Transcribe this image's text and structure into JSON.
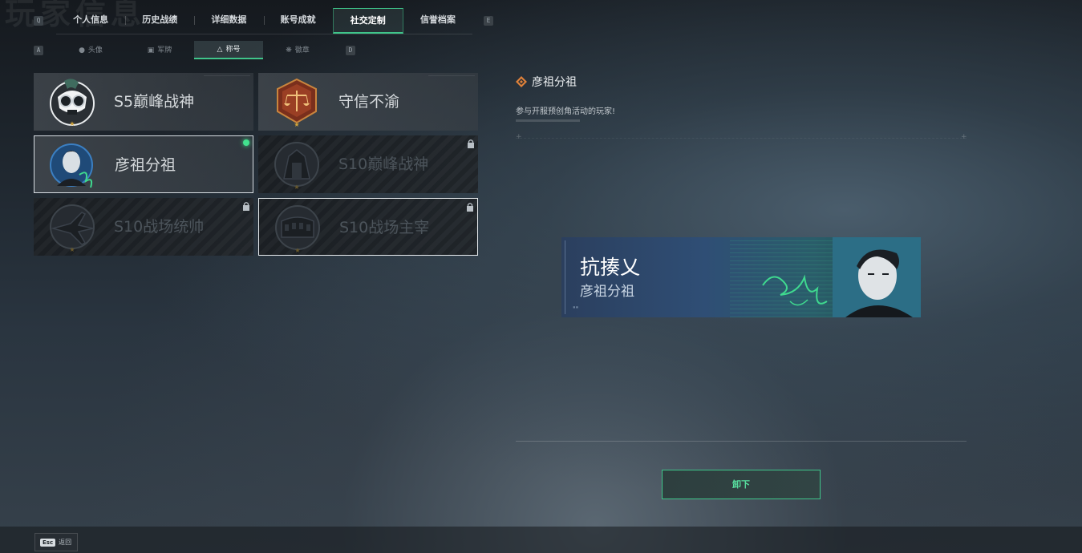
{
  "header": {
    "bg_title": "玩家信息",
    "left_key": "Q",
    "right_key": "E",
    "tabs": [
      "个人信息",
      "历史战绩",
      "详细数据",
      "账号成就",
      "社交定制",
      "信誉档案"
    ],
    "active_tab": "社交定制"
  },
  "subnav": {
    "left_key": "A",
    "right_key": "D",
    "tabs": [
      {
        "icon": "person-icon",
        "label": "头像"
      },
      {
        "icon": "card-icon",
        "label": "军牌"
      },
      {
        "icon": "triangle-icon",
        "label": "称号"
      },
      {
        "icon": "emblem-icon",
        "label": "徽章"
      }
    ],
    "active_tab": "称号"
  },
  "titles": [
    {
      "name": "S5巅峰战神",
      "locked": false,
      "emblem": "skull-goggles-emblem"
    },
    {
      "name": "守信不渝",
      "locked": false,
      "emblem": "scales-emblem"
    },
    {
      "name": "彦祖分祖",
      "locked": false,
      "equipped": true,
      "emblem": "portrait-emblem"
    },
    {
      "name": "S10巅峰战神",
      "locked": true,
      "emblem": "monument-emblem"
    },
    {
      "name": "S10战场统帅",
      "locked": true,
      "emblem": "aircraft-emblem"
    },
    {
      "name": "S10战场主宰",
      "locked": true,
      "emblem": "colosseum-emblem"
    }
  ],
  "detail": {
    "title": "彦祖分祖",
    "description": "参与开服预创角活动的玩家!"
  },
  "banner": {
    "player_name": "抗揍乂",
    "title": "彦祖分祖"
  },
  "actions": {
    "unequip_label": "卸下"
  },
  "footer": {
    "esc_key": "Esc",
    "back_label": "返回"
  },
  "colors": {
    "accent": "#3fc58a",
    "equipped": "#42e28e"
  }
}
